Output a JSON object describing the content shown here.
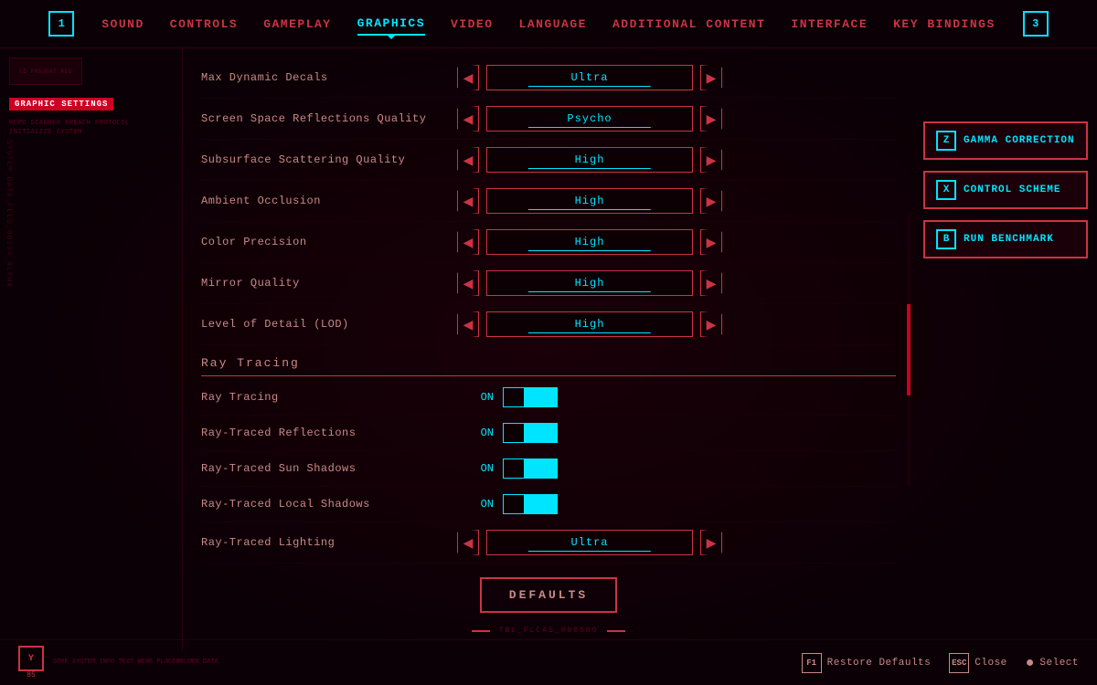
{
  "nav": {
    "left_btn": "1",
    "right_btn": "3",
    "items": [
      {
        "label": "SOUND",
        "active": false
      },
      {
        "label": "CONTROLS",
        "active": false
      },
      {
        "label": "GAMEPLAY",
        "active": false
      },
      {
        "label": "GRAPHICS",
        "active": true
      },
      {
        "label": "VIDEO",
        "active": false
      },
      {
        "label": "LANGUAGE",
        "active": false
      },
      {
        "label": "ADDITIONAL CONTENT",
        "active": false
      },
      {
        "label": "INTERFACE",
        "active": false
      },
      {
        "label": "KEY BINDINGS",
        "active": false
      }
    ]
  },
  "settings": {
    "rows": [
      {
        "label": "Max Dynamic Decals",
        "value": "Ultra"
      },
      {
        "label": "Screen Space Reflections Quality",
        "value": "Psycho"
      },
      {
        "label": "Subsurface Scattering Quality",
        "value": "High"
      },
      {
        "label": "Ambient Occlusion",
        "value": "High"
      },
      {
        "label": "Color Precision",
        "value": "High"
      },
      {
        "label": "Mirror Quality",
        "value": "High"
      },
      {
        "label": "Level of Detail (LOD)",
        "value": "High"
      }
    ],
    "ray_tracing_section": "Ray Tracing",
    "toggles": [
      {
        "label": "Ray Tracing",
        "value": "ON"
      },
      {
        "label": "Ray-Traced Reflections",
        "value": "ON"
      },
      {
        "label": "Ray-Traced Sun Shadows",
        "value": "ON"
      },
      {
        "label": "Ray-Traced Local Shadows",
        "value": "ON"
      }
    ],
    "ray_lighting": {
      "label": "Ray-Traced Lighting",
      "value": "Ultra"
    }
  },
  "side_actions": [
    {
      "key": "Z",
      "label": "GAMMA CORRECTION"
    },
    {
      "key": "X",
      "label": "CONTROL SCHEME"
    },
    {
      "key": "B",
      "label": "RUN BENCHMARK"
    }
  ],
  "defaults_btn": "DEFAULTS",
  "bottom": {
    "corner_val": "Y",
    "corner_sub": "85",
    "left_text": "SOME SYSTEM INFO TEXT HERE PLACEHOLDER DATA",
    "actions": [
      {
        "key": "F1",
        "label": "Restore Defaults"
      },
      {
        "key": "ESC",
        "label": "Close"
      }
    ],
    "select_label": "Select"
  },
  "status_text": "TBL_FLCAS_000000"
}
